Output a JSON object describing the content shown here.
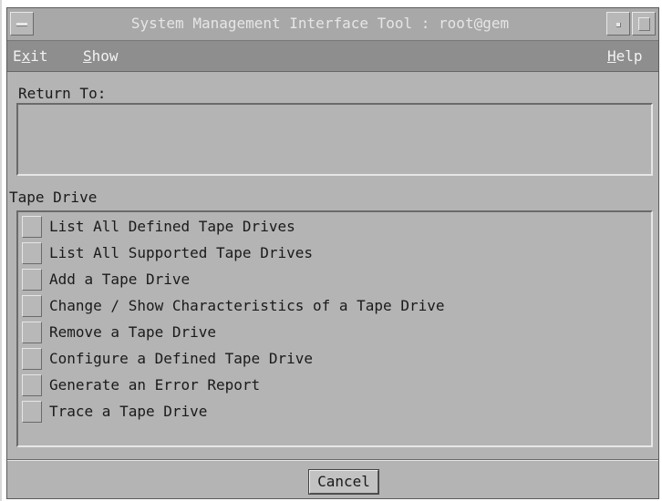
{
  "window": {
    "title": "System Management Interface Tool : root@gem"
  },
  "menubar": {
    "exit": {
      "pre": "E",
      "mnemonic": "x",
      "post": "it"
    },
    "show": {
      "pre": "",
      "mnemonic": "S",
      "post": "how"
    },
    "help": {
      "pre": "",
      "mnemonic": "H",
      "post": "elp"
    }
  },
  "return_to": {
    "label": "Return To:"
  },
  "tape_drive": {
    "label": "Tape Drive",
    "items": [
      "List All Defined Tape Drives",
      "List All Supported Tape Drives",
      "Add a Tape Drive",
      "Change / Show Characteristics of a Tape Drive",
      "Remove a Tape Drive",
      "Configure a Defined Tape Drive",
      "Generate an Error Report",
      "Trace a Tape Drive"
    ]
  },
  "footer": {
    "cancel_label": "Cancel"
  },
  "colors": {
    "window_bg": "#b4b4b4",
    "menubar_bg": "#8e8e8e",
    "title_text": "#e6e6e6"
  }
}
